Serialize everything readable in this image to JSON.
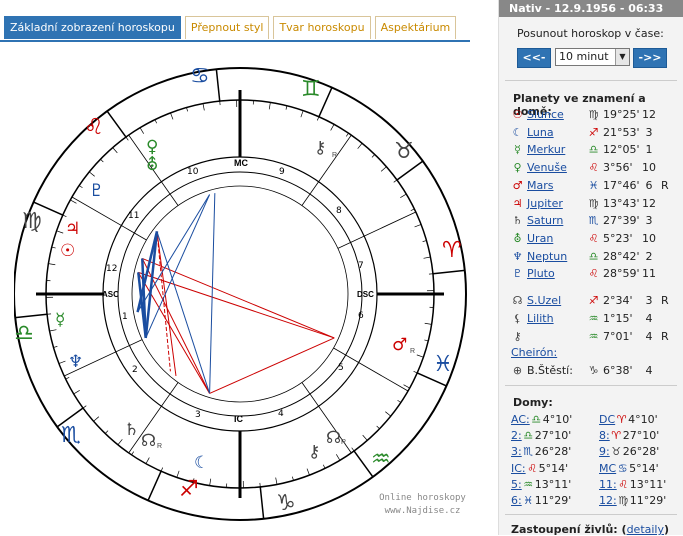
{
  "tabs": [
    {
      "label": "Základní zobrazení horoskopu",
      "active": true
    },
    {
      "label": "Přepnout styl",
      "active": false
    },
    {
      "label": "Tvar horoskopu",
      "active": false
    },
    {
      "label": "Aspektárium",
      "active": false
    }
  ],
  "watermark": {
    "line1": "Online horoskopy",
    "line2": "www.Najdise.cz"
  },
  "chart_labels": {
    "mc": "MC",
    "ic": "IC",
    "asc": "ASC",
    "dsc": "DSC"
  },
  "houses_numbers": [
    "1",
    "2",
    "3",
    "4",
    "5",
    "6",
    "7",
    "8",
    "9",
    "10",
    "11",
    "12"
  ],
  "header": {
    "title": "Nativ - 12.9.1956 - 06:33"
  },
  "shift": {
    "label": "Posunout horoskop v čase:",
    "back": "<<-",
    "forward": "->>",
    "selected": "10 minut"
  },
  "planets": {
    "title": "Planety ve znamení a domě:",
    "rows": [
      {
        "icon": "☉",
        "icon_color": "red",
        "name": "Slunce",
        "sign": "♍",
        "sign_color": "gray",
        "deg": "19°25'",
        "house": "12",
        "retro": ""
      },
      {
        "icon": "☾",
        "icon_color": "blue",
        "name": "Luna",
        "sign": "♐",
        "sign_color": "red",
        "deg": "21°53'",
        "house": "3",
        "retro": ""
      },
      {
        "icon": "☿",
        "icon_color": "green",
        "name": "Merkur",
        "sign": "♎",
        "sign_color": "green",
        "deg": "12°05'",
        "house": "1",
        "retro": ""
      },
      {
        "icon": "♀",
        "icon_color": "green",
        "name": "Venuše",
        "sign": "♌",
        "sign_color": "red",
        "deg": "3°56'",
        "house": "10",
        "retro": ""
      },
      {
        "icon": "♂",
        "icon_color": "red",
        "name": "Mars",
        "sign": "♓",
        "sign_color": "blue",
        "deg": "17°46'",
        "house": "6",
        "retro": "R"
      },
      {
        "icon": "♃",
        "icon_color": "red",
        "name": "Jupiter",
        "sign": "♍",
        "sign_color": "gray",
        "deg": "13°43'",
        "house": "12",
        "retro": ""
      },
      {
        "icon": "♄",
        "icon_color": "gray",
        "name": "Saturn",
        "sign": "♏",
        "sign_color": "blue",
        "deg": "27°39'",
        "house": "3",
        "retro": ""
      },
      {
        "icon": "⛢",
        "icon_color": "green",
        "name": "Uran",
        "sign": "♌",
        "sign_color": "red",
        "deg": "5°23'",
        "house": "10",
        "retro": ""
      },
      {
        "icon": "♆",
        "icon_color": "blue",
        "name": "Neptun",
        "sign": "♎",
        "sign_color": "green",
        "deg": "28°42'",
        "house": "2",
        "retro": ""
      },
      {
        "icon": "♇",
        "icon_color": "blue",
        "name": "Pluto",
        "sign": "♌",
        "sign_color": "red",
        "deg": "28°59'",
        "house": "11",
        "retro": ""
      }
    ]
  },
  "extra": [
    {
      "icon": "☊",
      "icon_color": "gray",
      "name": "S.Uzel",
      "sign": "♐",
      "sign_color": "red",
      "deg": "2°34'",
      "house": "3",
      "retro": "R",
      "link": true
    },
    {
      "icon": "⚸",
      "icon_color": "gray",
      "name": "Lilith",
      "sign": "♒",
      "sign_color": "green",
      "deg": "1°15'",
      "house": "4",
      "retro": "",
      "link": true
    },
    {
      "icon": "⚷",
      "icon_color": "gray",
      "name": "",
      "sign": "♒",
      "sign_color": "green",
      "deg": "7°01'",
      "house": "4",
      "retro": "R",
      "link": false
    },
    {
      "icon": "",
      "icon_color": "gray",
      "name": "Cheirón:",
      "sign": "",
      "sign_color": "gray",
      "deg": "",
      "house": "",
      "retro": "",
      "link": true
    },
    {
      "icon": "⊕",
      "icon_color": "gray",
      "name": "B.Štěstí:",
      "sign": "♑",
      "sign_color": "gray",
      "deg": "6°38'",
      "house": "4",
      "retro": "",
      "link": false
    }
  ],
  "houses": {
    "title": "Domy:",
    "left": [
      {
        "label": "AC:",
        "sign": "♎",
        "sign_color": "green",
        "deg": "4°10'"
      },
      {
        "label": "2:",
        "sign": "♎",
        "sign_color": "green",
        "deg": "27°10'"
      },
      {
        "label": "3:",
        "sign": "♏",
        "sign_color": "blue",
        "deg": "26°28'"
      },
      {
        "label": "IC:",
        "sign": "♌",
        "sign_color": "red",
        "deg": "5°14'"
      },
      {
        "label": "5:",
        "sign": "♒",
        "sign_color": "green",
        "deg": "13°11'"
      },
      {
        "label": "6:",
        "sign": "♓",
        "sign_color": "blue",
        "deg": "11°29'"
      }
    ],
    "right": [
      {
        "label": "DC",
        "sign": "♈",
        "sign_color": "red",
        "deg": "4°10'"
      },
      {
        "label": "8:",
        "sign": "♈",
        "sign_color": "red",
        "deg": "27°10'"
      },
      {
        "label": "9:",
        "sign": "♉",
        "sign_color": "gray",
        "deg": "26°28'"
      },
      {
        "label": "MC",
        "sign": "♋",
        "sign_color": "blue",
        "deg": "5°14'"
      },
      {
        "label": "11:",
        "sign": "♌",
        "sign_color": "red",
        "deg": "13°11'"
      },
      {
        "label": "12:",
        "sign": "♍",
        "sign_color": "gray",
        "deg": "11°29'"
      }
    ]
  },
  "footer": {
    "label": "Zastoupení živlů:",
    "link": "detaily"
  }
}
